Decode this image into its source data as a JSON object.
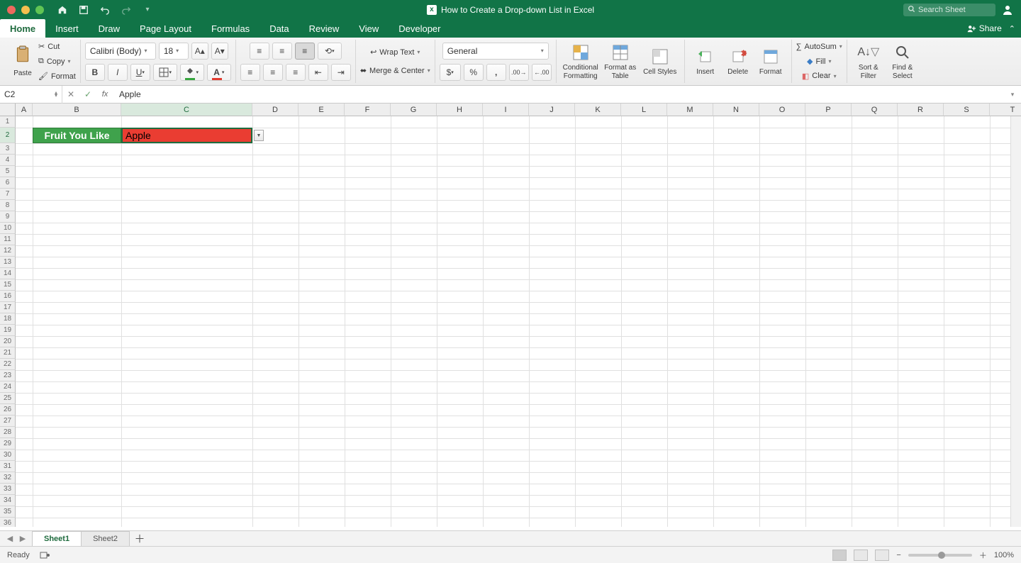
{
  "titlebar": {
    "doc_title": "How to Create a Drop-down List in Excel",
    "search_placeholder": "Search Sheet"
  },
  "tabs": {
    "items": [
      "Home",
      "Insert",
      "Draw",
      "Page Layout",
      "Formulas",
      "Data",
      "Review",
      "View",
      "Developer"
    ],
    "active": 0,
    "share_label": "Share"
  },
  "ribbon": {
    "paste_label": "Paste",
    "cut_label": "Cut",
    "copy_label": "Copy",
    "format_painter_label": "Format",
    "font_name": "Calibri (Body)",
    "font_size": "18",
    "wrap_label": "Wrap Text",
    "merge_label": "Merge & Center",
    "number_format": "General",
    "cond_fmt_label": "Conditional Formatting",
    "fmt_table_label": "Format as Table",
    "cell_styles_label": "Cell Styles",
    "insert_label": "Insert",
    "delete_label": "Delete",
    "format_label": "Format",
    "autosum_label": "AutoSum",
    "fill_label": "Fill",
    "clear_label": "Clear",
    "sort_label": "Sort & Filter",
    "find_label": "Find & Select"
  },
  "formula_bar": {
    "cell_ref": "C2",
    "formula": "Apple"
  },
  "grid": {
    "col_letters": [
      "A",
      "B",
      "C",
      "D",
      "E",
      "F",
      "G",
      "H",
      "I",
      "J",
      "K",
      "L",
      "M",
      "N",
      "O",
      "P",
      "Q",
      "R",
      "S",
      "T"
    ],
    "row_count": 36,
    "col_widths": {
      "A": 24,
      "default": 65,
      "B": 125,
      "C": 185
    },
    "row_heights": {
      "default": 16,
      "2": 22
    },
    "b2_text": "Fruit You Like",
    "c2_text": "Apple",
    "selected_cell": "C2"
  },
  "sheets": {
    "tabs": [
      "Sheet1",
      "Sheet2"
    ],
    "active": 0
  },
  "status": {
    "ready": "Ready",
    "zoom": "100%"
  }
}
